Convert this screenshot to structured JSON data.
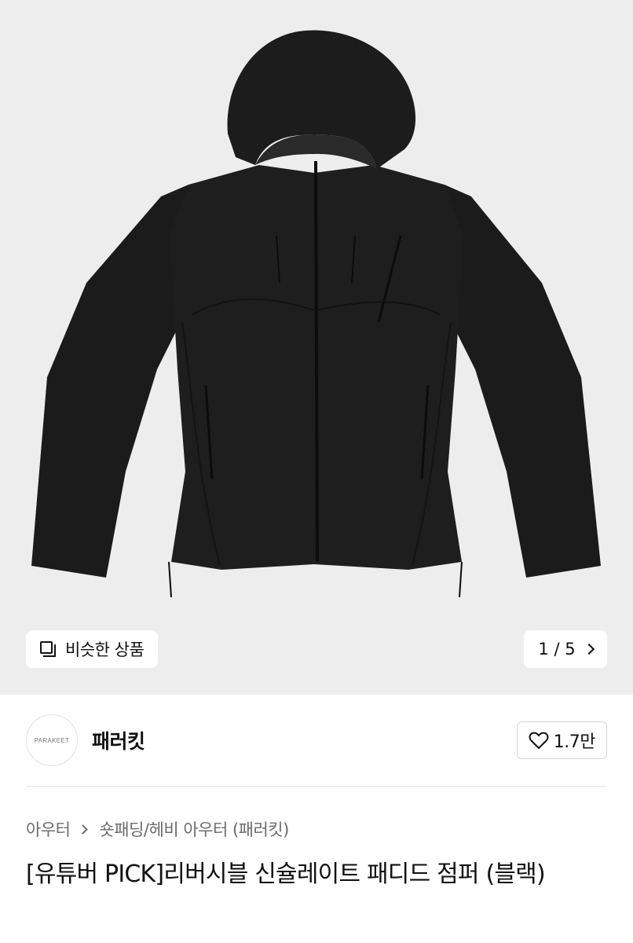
{
  "product_image": {
    "alt_icon": "black-hooded-padded-jacket"
  },
  "similar_button": {
    "icon": "stack-icon",
    "label": "비슷한 상품"
  },
  "pager": {
    "text": "1 / 5",
    "icon": "chevron-right-icon"
  },
  "shop": {
    "logo_text": "PARAKEET",
    "name": "패러킷",
    "like_icon": "heart-icon",
    "like_count": "1.7만"
  },
  "breadcrumb": {
    "category": "아우터",
    "subcategory": "숏패딩/헤비 아우터 (패러킷)"
  },
  "product": {
    "title": "[유튜버 PICK]리버시블 신슐레이트 패디드 점퍼 (블랙)"
  },
  "colors": {
    "background": "#ededed",
    "jacket": "#1a1a1a",
    "text": "#111111",
    "muted": "#6b6b6b"
  }
}
